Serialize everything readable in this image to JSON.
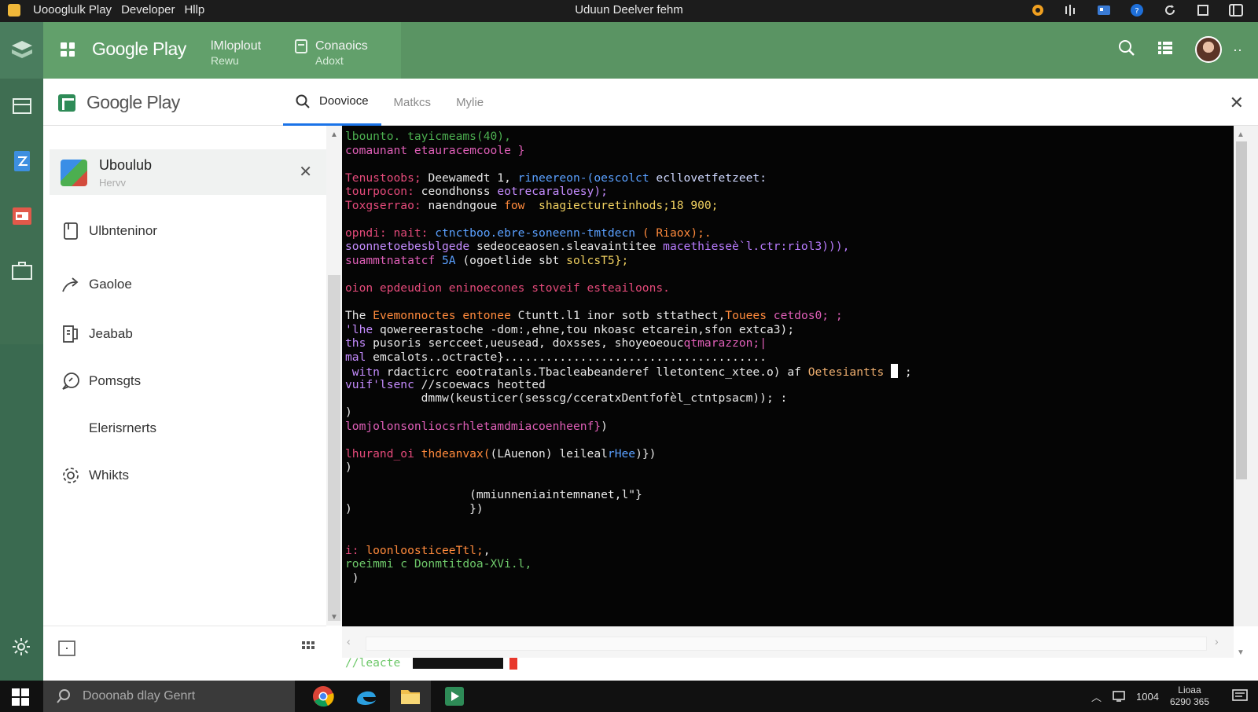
{
  "window": {
    "menu": [
      "Uoooglulk Play",
      "Developer",
      "Hllp"
    ],
    "title": "Uduun Deelver fehm"
  },
  "header": {
    "brand": "Google Play",
    "nav": [
      {
        "label": "lMloplout",
        "sub": "Rewu"
      },
      {
        "label": "Conaoics",
        "sub": "Adoxt"
      }
    ]
  },
  "app": {
    "brand": "Google Play",
    "tabs": [
      "Doovioce",
      "Matkcs",
      "Mylie"
    ],
    "active_tab": "Doovioce"
  },
  "sidebar": {
    "card": {
      "title": "Uboulub",
      "subtitle": "Hervv"
    },
    "items": [
      {
        "label": "Ulbnteninor",
        "icon": "document-icon"
      },
      {
        "label": "Gaoloe",
        "icon": "share-icon"
      },
      {
        "label": "Jeabab",
        "icon": "book-icon"
      },
      {
        "label": "Pomsgts",
        "icon": "speech-icon"
      },
      {
        "label": "Elerisrnerts",
        "icon": ""
      },
      {
        "label": "Whikts",
        "icon": "gear-icon"
      }
    ]
  },
  "terminal": {
    "lines": [
      [
        {
          "t": "lbounto. tayicmeams(40),",
          "c": "#4caf50"
        }
      ],
      [
        {
          "t": "comaunant etauracemcoole }",
          "c": "#e05fb8"
        }
      ],
      [],
      [
        {
          "t": "Tenustoobs; ",
          "c": "#e44a7a"
        },
        {
          "t": "Deewamedt 1, ",
          "c": "#e8e8e8"
        },
        {
          "t": "rineereon-(oescolct ",
          "c": "#5aa0ff"
        },
        {
          "t": "ecllovetfetzeet:",
          "c": "#cfd8ff"
        }
      ],
      [
        {
          "t": "tourpocon: ",
          "c": "#e44a7a"
        },
        {
          "t": "ceondhonss ",
          "c": "#e8e8e8"
        },
        {
          "t": "eotrecaraloesy);",
          "c": "#c58cff"
        }
      ],
      [
        {
          "t": "Toxgserrao: ",
          "c": "#e44a7a"
        },
        {
          "t": "naendngoue ",
          "c": "#e8e8e8"
        },
        {
          "t": "fow  ",
          "c": "#ff8a3c"
        },
        {
          "t": "shagiecturetinhods;18 900;",
          "c": "#f0d060"
        }
      ],
      [],
      [
        {
          "t": "opndi: nait: ",
          "c": "#e44a7a"
        },
        {
          "t": "ctnctboo.ebre-soneenn-tmtdecn ",
          "c": "#5aa0ff"
        },
        {
          "t": "( Riaox);.",
          "c": "#ff8a3c"
        }
      ],
      [
        {
          "t": "soonnetoebesblgede ",
          "c": "#c58cff"
        },
        {
          "t": "sedeoceaosen.sleavaintitee ",
          "c": "#e8e8e8"
        },
        {
          "t": "macethieseè`l.ctr:riol3))),",
          "c": "#b97cff"
        }
      ],
      [
        {
          "t": "suammtnatatcf ",
          "c": "#e05fb8"
        },
        {
          "t": "5A ",
          "c": "#5aa0ff"
        },
        {
          "t": "(ogoetlide sbt ",
          "c": "#e8e8e8"
        },
        {
          "t": "solcsT5};",
          "c": "#f0d060"
        }
      ],
      [],
      [
        {
          "t": "oion epdeudion eninoecones stoveif esteailoons.",
          "c": "#e44a7a"
        }
      ],
      [],
      [
        {
          "t": "The ",
          "c": "#e8e8e8"
        },
        {
          "t": "Evemonnoctes entonee ",
          "c": "#ff8a3c"
        },
        {
          "t": "Ctuntt.l1 ",
          "c": "#e8e8e8"
        },
        {
          "t": "inor sotb sttathect,",
          "c": "#e8e8e8"
        },
        {
          "t": "Touees ",
          "c": "#ff8a3c"
        },
        {
          "t": "cetdos0; ;",
          "c": "#e05fb8"
        }
      ],
      [
        {
          "t": "'lhe ",
          "c": "#c58cff"
        },
        {
          "t": "qowereerastoche -dom:,ehne,tou nkoasc etcarein,sfon extca3);",
          "c": "#e8e8e8"
        }
      ],
      [
        {
          "t": "ths ",
          "c": "#c58cff"
        },
        {
          "t": "pusoris sercceet,ueusead, doxsses, shoyeoeouc",
          "c": "#e8e8e8"
        },
        {
          "t": "qtmarazzon;|",
          "c": "#e05fb8"
        }
      ],
      [
        {
          "t": "mal ",
          "c": "#c58cff"
        },
        {
          "t": "emcalots..octracte}......................................",
          "c": "#e8e8e8"
        }
      ],
      [
        {
          "t": " witn ",
          "c": "#c58cff"
        },
        {
          "t": "rdacticrc eootratanls.Tbacleabeanderef lletontenc_xtee.o) af ",
          "c": "#e8e8e8"
        },
        {
          "t": "Oetesiantts ",
          "c": "#f0b070"
        },
        {
          "t": "{CURSOR}",
          "c": "#ffffff"
        },
        {
          "t": " ;",
          "c": "#e8e8e8"
        }
      ],
      [
        {
          "t": "vuif'lsenc ",
          "c": "#c58cff"
        },
        {
          "t": "//scoewacs ",
          "c": "#e8e8e8"
        },
        {
          "t": "heotted",
          "c": "#e8e8e8"
        }
      ],
      [
        {
          "t": "           dmmw(keusticer(sesscg/cceratxDentfofèl_ctntpsacm)); ",
          "c": "#e8e8e8"
        },
        {
          "t": ":",
          "c": "#e8e8e8"
        }
      ],
      [
        {
          "t": ")",
          "c": "#e8e8e8"
        }
      ],
      [
        {
          "t": "lomjolonsonliocsrhletamdmiacoenheenf}",
          "c": "#e05fb8"
        },
        {
          "t": ")",
          "c": "#e8e8e8"
        }
      ],
      [],
      [
        {
          "t": "lhurand_oi ",
          "c": "#e44a7a"
        },
        {
          "t": "thdeanvax(",
          "c": "#ff8a3c"
        },
        {
          "t": "(LAuenon) leileal",
          "c": "#e8e8e8"
        },
        {
          "t": "rHee",
          "c": "#5aa0ff"
        },
        {
          "t": ")})",
          "c": "#e8e8e8"
        }
      ],
      [
        {
          "t": ")",
          "c": "#e8e8e8"
        }
      ],
      [],
      [
        {
          "t": "                  (mmiunneniaintemnanet,l\"}",
          "c": "#e8e8e8"
        }
      ],
      [
        {
          "t": ")                 })",
          "c": "#e8e8e8"
        }
      ],
      [],
      [],
      [
        {
          "t": "i: ",
          "c": "#e44a7a"
        },
        {
          "t": "loonloosticeeTtl;",
          "c": "#ff8a3c"
        },
        {
          "t": ",",
          "c": "#e8e8e8"
        }
      ],
      [
        {
          "t": "roeimmi c Donmtitdoa-XVi.l,",
          "c": "#6ec86a"
        }
      ],
      [
        {
          "t": " )",
          "c": "#e8e8e8"
        }
      ],
      [],
      [],
      [],
      [
        {
          "t": "):",
          "c": "#e8e8e8"
        }
      ],
      [],
      [
        {
          "t": "//leacte ",
          "c": "#6ec86a"
        },
        {
          "t": "{CURSOR}",
          "c": "#ffffff"
        }
      ]
    ]
  },
  "taskbar": {
    "search_placeholder": "Dooonab dlay Genrt",
    "time": "1004",
    "clock_top": "Lioaa",
    "clock_bottom": "6290 365"
  },
  "colors": {
    "header_green": "#5a9463",
    "rail_green": "#3f6e52",
    "terminal_bg": "#050505",
    "accent_blue": "#1a73e8",
    "cursor_red": "#e8382c"
  }
}
